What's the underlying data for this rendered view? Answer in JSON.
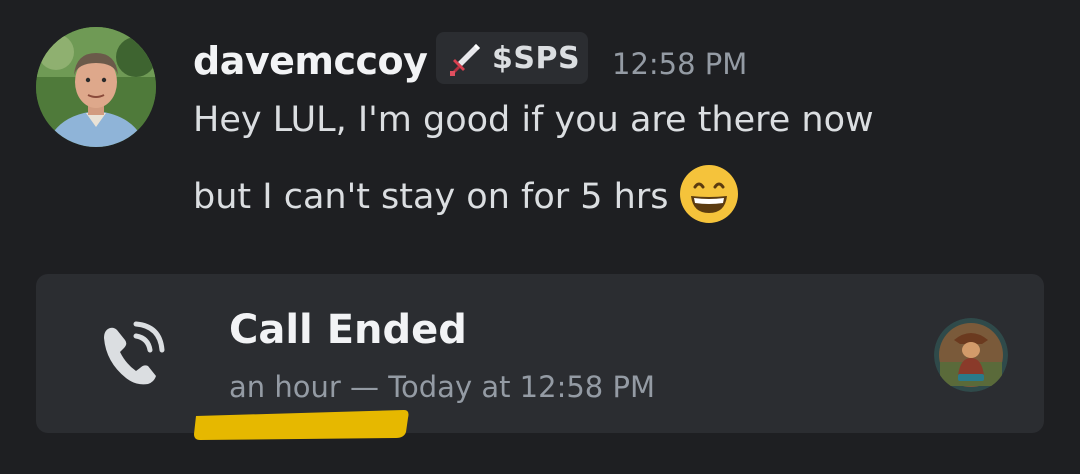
{
  "message": {
    "username": "davemccoy",
    "role_badge": {
      "icon": "sword-icon",
      "label": "$SPS"
    },
    "timestamp": "12:58 PM",
    "text_line1": "Hey LUL, I'm good if you are there now",
    "text_line2": "but I can't stay on for 5 hrs",
    "emoji": "grinning-face-emoji"
  },
  "call": {
    "icon": "phone-call-icon",
    "title": "Call Ended",
    "meta": "an hour — Today at 12:58 PM"
  },
  "colors": {
    "background": "#1e1f22",
    "card": "#2b2d31",
    "username": "#f2f3f5",
    "text": "#dbdee1",
    "muted": "#949ba4",
    "highlight": "#e6b800"
  }
}
